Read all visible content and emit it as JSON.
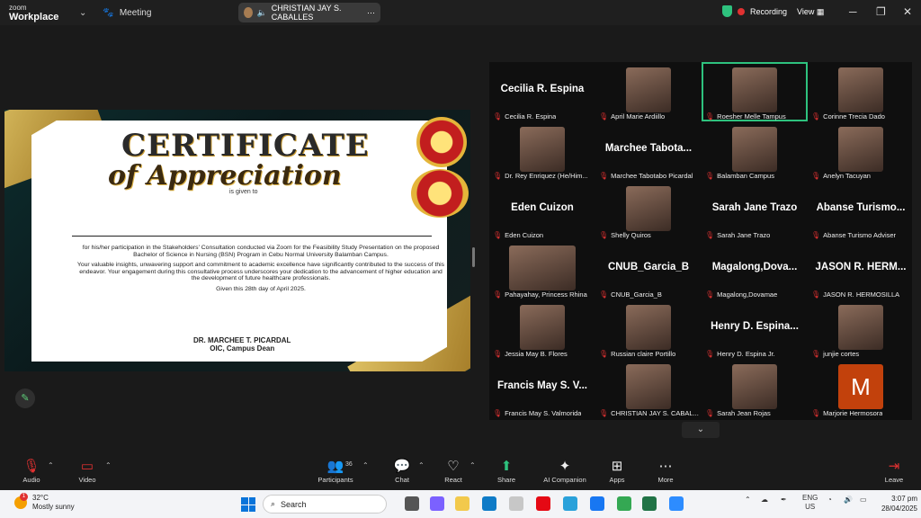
{
  "titlebar": {
    "logo_line1": "zoom",
    "logo_line2": "Workplace",
    "meeting_label": "Meeting",
    "share_name": "CHRISTIAN JAY S. CABALLES",
    "recording_label": "Recording",
    "view_label": "View"
  },
  "certificate": {
    "title": "CERTIFICATE",
    "subtitle": "of Appreciation",
    "given": "is given to",
    "p1": "for his/her participation in the Stakeholders' Consultation conducted via Zoom for the Feasibility Study Presentation on the proposed Bachelor of Science in Nursing (BSN) Program in Cebu Normal University Balamban Campus.",
    "p2": "Your valuable insights, unwavering support and commitment to academic excellence have significantly contributed to the success of this endeavor. Your engagement during this consultative process underscores your dedication to the advancement of higher education and the development of future healthcare professionals.",
    "date": "Given this 28th day of April 2025.",
    "signer": "DR. MARCHEE T. PICARDAL",
    "signer_title": "OIC, Campus Dean"
  },
  "participants": [
    {
      "big": "Cecilia R. Espina",
      "label": "Cecilia R. Espina"
    },
    {
      "big": "",
      "label": "April Marie Ardiillo"
    },
    {
      "big": "",
      "label": "Roesher Melle Tampus"
    },
    {
      "big": "",
      "label": "Corinne Trecia Dado"
    },
    {
      "big": "",
      "label": "Dr. Rey Enriquez (He/Him..."
    },
    {
      "big": "Marchee Tabota...",
      "label": "Marchee Tabotabo Picardal"
    },
    {
      "big": "",
      "label": "Balamban Campus"
    },
    {
      "big": "",
      "label": "Anelyn Tacuyan"
    },
    {
      "big": "Eden Cuizon",
      "label": "Eden Cuizon"
    },
    {
      "big": "",
      "label": "Shelly Quiros"
    },
    {
      "big": "Sarah Jane Trazo",
      "label": "Sarah Jane Trazo"
    },
    {
      "big": "Abanse Turismo...",
      "label": "Abanse Turismo Adviser"
    },
    {
      "big": "",
      "label": "Pahayahay, Princess Rhina"
    },
    {
      "big": "CNUB_Garcia_B",
      "label": "CNUB_Garcia_B"
    },
    {
      "big": "Magalong,Dova...",
      "label": "Magalong,Dovamae"
    },
    {
      "big": "JASON R. HERM...",
      "label": "JASON R. HERMOSILLA"
    },
    {
      "big": "",
      "label": "Jessia May B. Flores"
    },
    {
      "big": "",
      "label": "Russian claire Portillo"
    },
    {
      "big": "Henry D. Espina...",
      "label": "Henry D. Espina Jr."
    },
    {
      "big": "",
      "label": "junjie cortes"
    },
    {
      "big": "Francis May S. V...",
      "label": "Francis May S. Valmorida"
    },
    {
      "big": "",
      "label": "CHRISTIAN JAY S. CABAL..."
    },
    {
      "big": "",
      "label": "Sarah Jean Rojas"
    },
    {
      "big": "M",
      "label": "Marjorie Hermosora"
    }
  ],
  "toolbar": {
    "audio": "Audio",
    "video": "Video",
    "participants": "Participants",
    "participants_count": "36",
    "chat": "Chat",
    "react": "React",
    "share": "Share",
    "ai": "AI Companion",
    "apps": "Apps",
    "more": "More",
    "leave": "Leave"
  },
  "taskbar": {
    "temp": "32°C",
    "weather": "Mostly sunny",
    "search": "Search",
    "lang1": "ENG",
    "lang2": "US",
    "time": "3:07 pm",
    "date": "28/04/2025",
    "weather_badge": "1"
  }
}
